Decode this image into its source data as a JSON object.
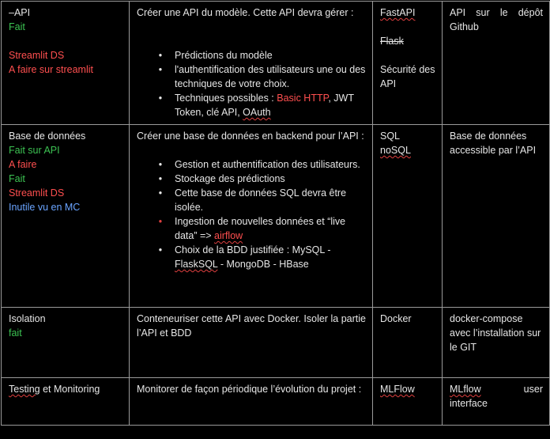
{
  "rows": [
    {
      "col1": [
        {
          "text": "–API",
          "color": "default"
        },
        {
          "text": "Fait",
          "color": "#3cc252"
        },
        {
          "text": "Streamlit DS",
          "color": "#ff4f4f"
        },
        {
          "text": "A faire sur streamlit",
          "color": "#ff4f4f"
        }
      ],
      "col2_intro": "Créer une API du modèle. Cette API devra gérer :",
      "col2_bullets": [
        "Prédictions du modèle",
        "l'authentification des utilisateurs une ou des techniques de votre choix.",
        {
          "prefix": "Techniques possibles : ",
          "highlight": "Basic HTTP",
          "middle": ", JWT Token, clé API, ",
          "last": "OAuth"
        }
      ],
      "col3": [
        "FastAPI",
        "Flask",
        "Sécurité des API"
      ],
      "col4": "API sur le dépôt Github"
    },
    {
      "col1": [
        {
          "text": "Base de données",
          "color": "default"
        },
        {
          "text": "Fait sur API",
          "color": "#3cc252"
        },
        {
          "text": "A faire",
          "color": "#ff4f4f"
        },
        {
          "text": "Fait",
          "color": "#3cc252"
        },
        {
          "text": "Streamlit DS",
          "color": "#ff4f4f"
        },
        {
          "text": "Inutile vu en MC",
          "color": "#6aa4ff"
        }
      ],
      "col2_intro": "Créer une base de données en backend pour l’API :",
      "col2_bullets": [
        "Gestion et authentification des utilisateurs.",
        "Stockage des prédictions",
        "Cette base de données SQL devra être isolée.",
        {
          "prefix": "Ingestion de nouvelles données et “live data”  => ",
          "link": "airflow"
        },
        {
          "prefix": "Choix de la BDD justifiée : MySQL - ",
          "underlined": "FlaskSQL",
          "suffix": " - MongoDB - HBase"
        }
      ],
      "col3": [
        "SQL",
        "noSQL"
      ],
      "col4": "Base de données accessible par l’API"
    },
    {
      "col1": [
        {
          "text": "Isolation",
          "color": "default"
        },
        {
          "text": "fait",
          "color": "#3cc252"
        }
      ],
      "col2": "Conteneuriser cette API avec Docker. Isoler la partie l’API et BDD",
      "col3": [
        "Docker"
      ],
      "col4": "docker-compose avec l’installation sur le GIT"
    },
    {
      "col1": [
        {
          "text_a": "Testing",
          "text_b": " et Monitoring",
          "color": "default"
        }
      ],
      "col2": "Monitorer de façon périodique l’évolution du projet :",
      "col3": [
        "MLFlow"
      ],
      "col4_a": "MLflow",
      "col4_b": "user",
      "col4_c": "interface"
    }
  ],
  "colors": {
    "text": "#e6e6e6",
    "done": "#3cc252",
    "todo": "#ff4f4f",
    "info": "#6aa4ff",
    "border": "#9a9a9a",
    "background": "#000000"
  },
  "icons": {
    "bullet": "bullet-icon"
  }
}
